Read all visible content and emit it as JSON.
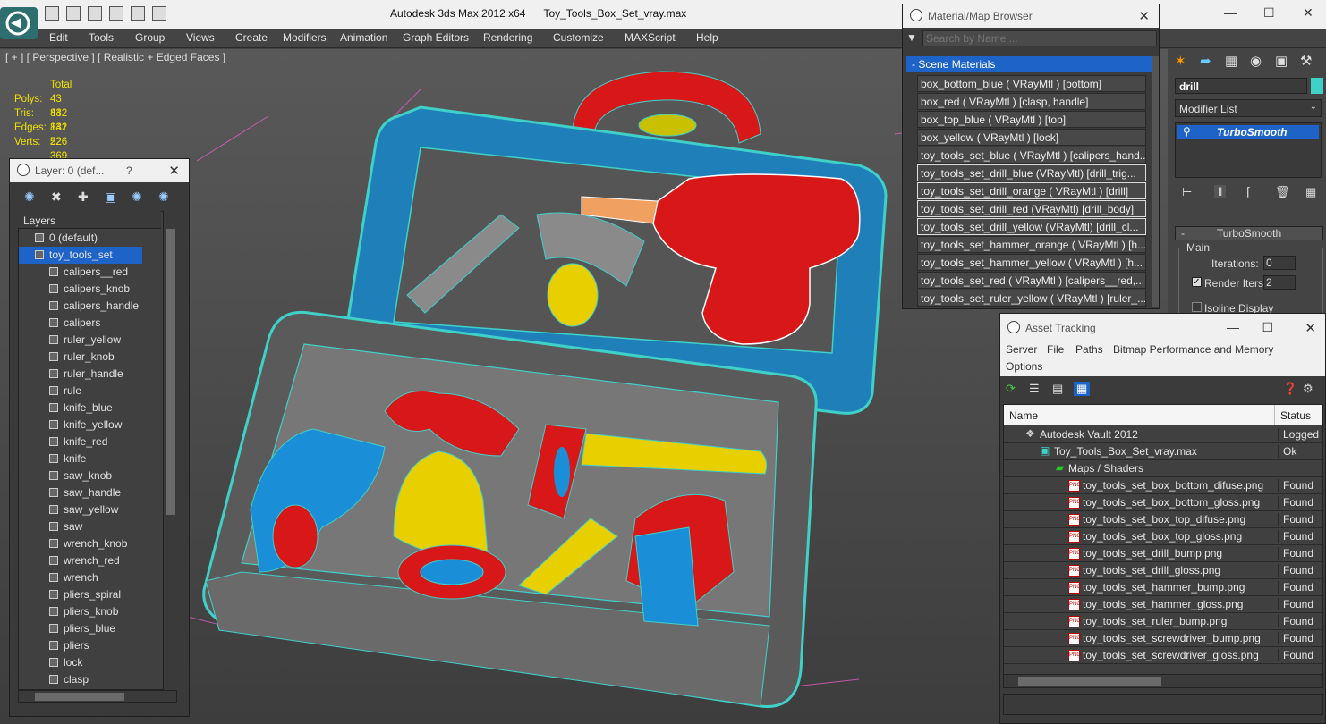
{
  "app": {
    "title": "Autodesk 3ds Max  2012 x64",
    "file": "Toy_Tools_Box_Set_vray.max"
  },
  "menu": [
    "Edit",
    "Tools",
    "Group",
    "Views",
    "Create",
    "Modifiers",
    "Animation",
    "Graph Editors",
    "Rendering",
    "Customize",
    "MAXScript",
    "Help"
  ],
  "viewport": {
    "label": "[ + ] [ Perspective ] [ Realistic + Edged Faces ]",
    "stats": {
      "header": "Total",
      "rows": [
        {
          "label": "Polys:",
          "value": "43 842"
        },
        {
          "label": "Tris:",
          "value": "43 842"
        },
        {
          "label": "Edges:",
          "value": "131 526"
        },
        {
          "label": "Verts:",
          "value": "22 369"
        }
      ]
    }
  },
  "layer_panel": {
    "title": "Layer: 0 (def...",
    "help": "?",
    "column_header": "Layers",
    "items": [
      "0 (default)",
      "toy_tools_set",
      "calipers__red",
      "calipers_knob",
      "calipers_handle",
      "calipers",
      "ruler_yellow",
      "ruler_knob",
      "ruler_handle",
      "rule",
      "knife_blue",
      "knife_yellow",
      "knife_red",
      "knife",
      "saw_knob",
      "saw_handle",
      "saw_yellow",
      "saw",
      "wrench_knob",
      "wrench_red",
      "wrench",
      "pliers_spiral",
      "pliers_knob",
      "pliers_blue",
      "pliers",
      "lock",
      "clasp"
    ]
  },
  "material_browser": {
    "title": "Material/Map Browser",
    "search_placeholder": "Search by Name ...",
    "group": "- Scene Materials",
    "items": [
      "box_bottom_blue  ( VRayMtl )  [bottom]",
      "box_red  ( VRayMtl )  [clasp, handle]",
      "box_top_blue  ( VRayMtl )  [top]",
      "box_yellow  ( VRayMtl )  [lock]",
      "toy_tools_set_blue  ( VRayMtl )  [calipers_hand...",
      "toy_tools_set_drill_blue  (VRayMtl)  [drill_trig...",
      "toy_tools_set_drill_orange  ( VRayMtl )  [drill]",
      "toy_tools_set_drill_red  (VRayMtl)  [drill_body]",
      "toy_tools_set_drill_yellow  (VRayMtl)  [drill_cl...",
      "toy_tools_set_hammer_orange  ( VRayMtl )  [h...",
      "toy_tools_set_hammer_yellow  ( VRayMtl )  [h...",
      "toy_tools_set_red  ( VRayMtl )  [calipers__red,...",
      "toy_tools_set_ruler_yellow  ( VRayMtl )  [ruler_..."
    ]
  },
  "command_panel": {
    "object_name": "drill",
    "modifier_list": "Modifier List",
    "stack_item": "TurboSmooth",
    "rollout": "TurboSmooth",
    "group": "Main",
    "iterations_label": "Iterations:",
    "iterations_value": "0",
    "render_iters_label": "Render Iters:",
    "render_iters_value": "2",
    "isoline_label": "Isoline Display"
  },
  "asset_tracking": {
    "title": "Asset Tracking",
    "menu": [
      "Server",
      "File",
      "Paths",
      "Bitmap Performance and Memory"
    ],
    "menu2": "Options",
    "col_name": "Name",
    "col_status": "Status",
    "rows": [
      {
        "name": "Autodesk Vault 2012",
        "status": "Logged O"
      },
      {
        "name": "Toy_Tools_Box_Set_vray.max",
        "status": "Ok"
      },
      {
        "name": "Maps / Shaders",
        "status": ""
      },
      {
        "name": "toy_tools_set_box_bottom_difuse.png",
        "status": "Found"
      },
      {
        "name": "toy_tools_set_box_bottom_gloss.png",
        "status": "Found"
      },
      {
        "name": "toy_tools_set_box_top_difuse.png",
        "status": "Found"
      },
      {
        "name": "toy_tools_set_box_top_gloss.png",
        "status": "Found"
      },
      {
        "name": "toy_tools_set_drill_bump.png",
        "status": "Found"
      },
      {
        "name": "toy_tools_set_drill_gloss.png",
        "status": "Found"
      },
      {
        "name": "toy_tools_set_hammer_bump.png",
        "status": "Found"
      },
      {
        "name": "toy_tools_set_hammer_gloss.png",
        "status": "Found"
      },
      {
        "name": "toy_tools_set_ruler_bump.png",
        "status": "Found"
      },
      {
        "name": "toy_tools_set_screwdriver_bump.png",
        "status": "Found"
      },
      {
        "name": "toy_tools_set_screwdriver_gloss.png",
        "status": "Found"
      }
    ]
  },
  "colors": {
    "wire_cyan": "#3fd0c8",
    "toy_red": "#d81818",
    "toy_yellow": "#e8d000",
    "toy_blue": "#1a8fd8",
    "stats_yellow": "#f0e000",
    "selection_blue": "#1e63c8"
  }
}
